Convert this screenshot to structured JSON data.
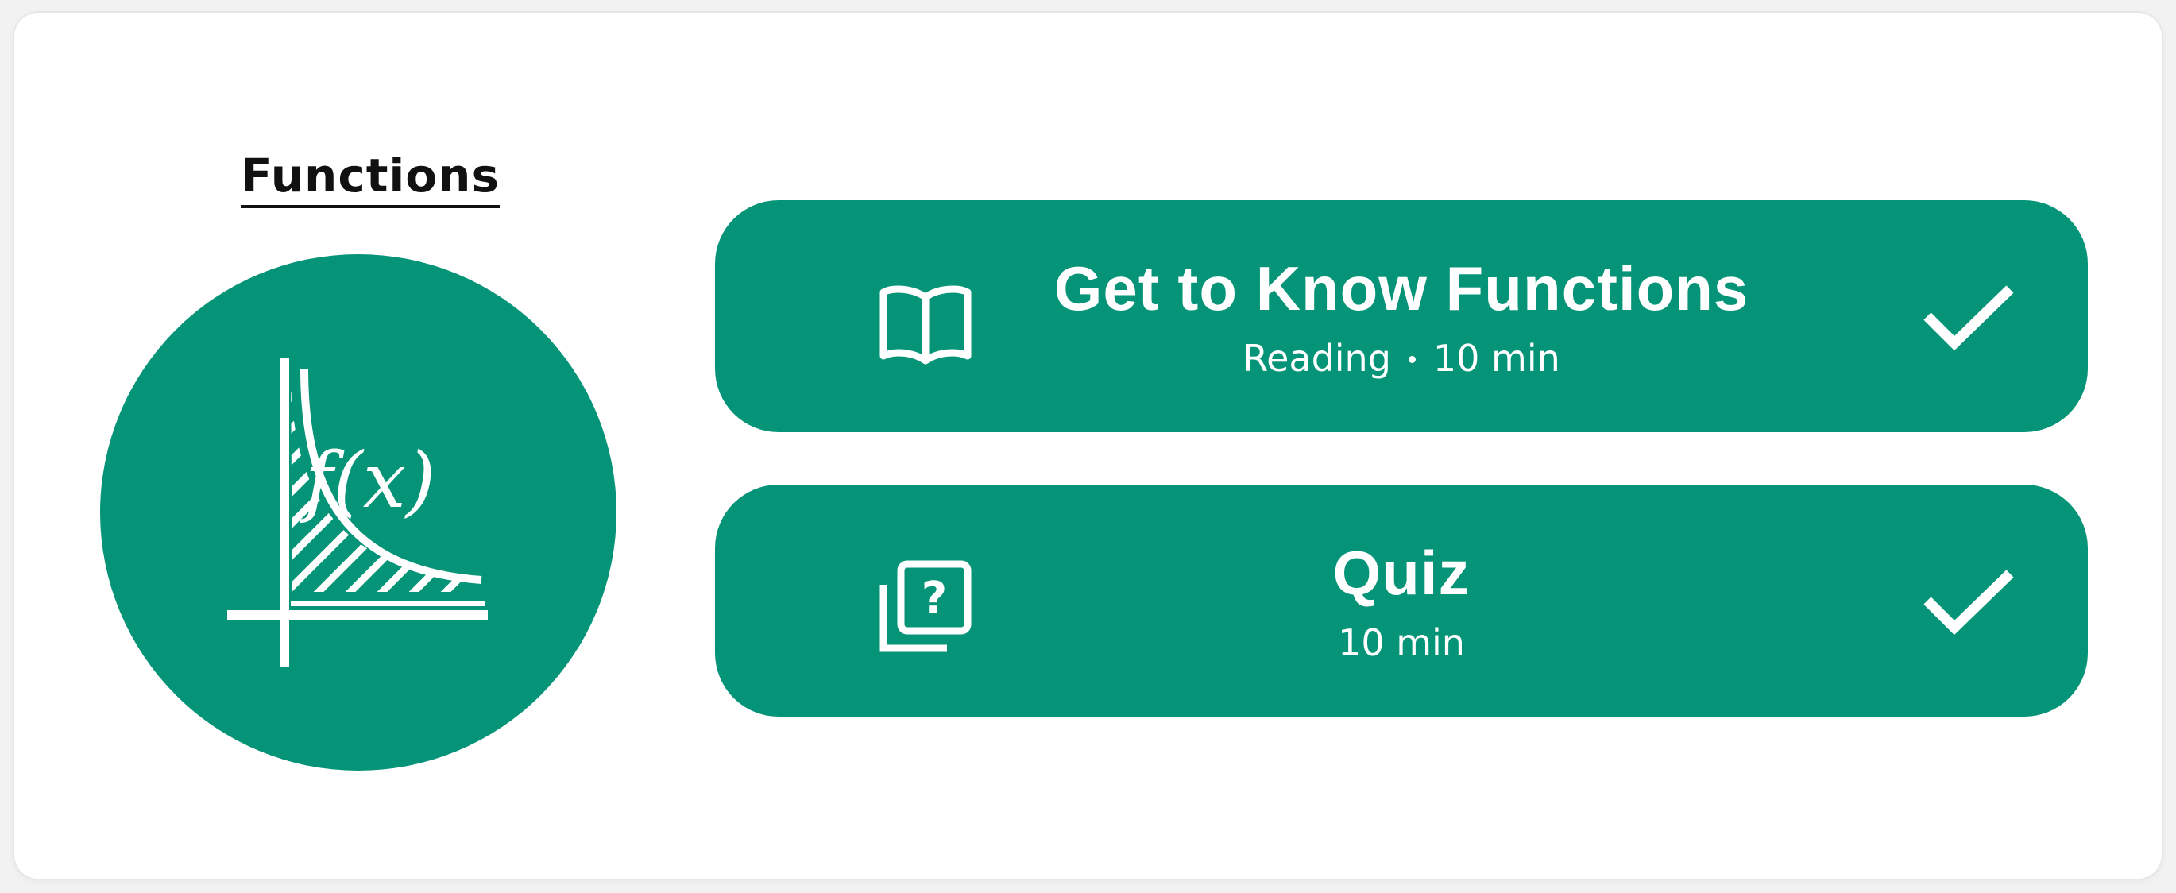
{
  "topic": {
    "title": "Functions",
    "icon": "function-graph-icon",
    "icon_label": "f(x)"
  },
  "lessons": [
    {
      "title": "Get to Know Functions",
      "type": "Reading",
      "duration": "10 min",
      "icon": "open-book-icon",
      "status_icon": "check-icon",
      "completed": true
    },
    {
      "title": "Quiz",
      "duration": "10 min",
      "icon": "quiz-cards-icon",
      "status_icon": "check-icon",
      "completed": true
    }
  ],
  "colors": {
    "accent": "#069478",
    "card_background": "#ffffff",
    "page_background": "#f2f2f2",
    "text_dark": "#111111",
    "text_light": "#ffffff"
  }
}
